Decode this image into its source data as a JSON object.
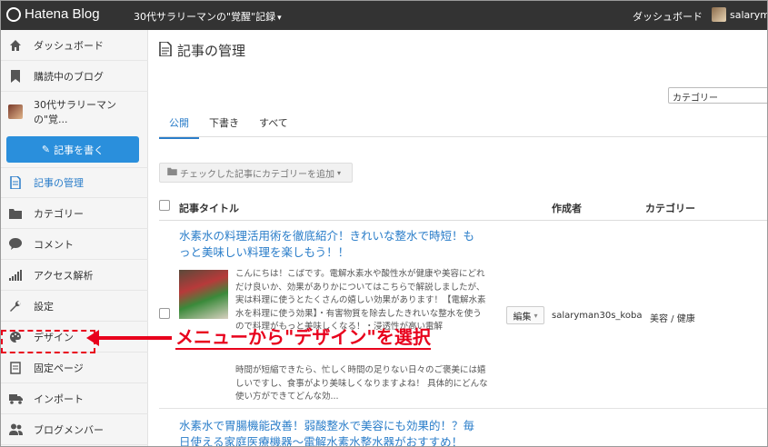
{
  "topbar": {
    "logo": "Hatena Blog",
    "blog_name": "30代サラリーマンの\"覚醒\"記録",
    "dashboard_link": "ダッシュボード",
    "username": "salaryma"
  },
  "sidebar": {
    "items": [
      {
        "label": "ダッシュボード",
        "icon": "home-icon"
      },
      {
        "label": "購読中のブログ",
        "icon": "bookmark-icon"
      },
      {
        "label": "30代サラリーマンの\"覚...",
        "icon": "blog-avatar"
      },
      {
        "label": "記事の管理",
        "icon": "document-icon"
      },
      {
        "label": "カテゴリー",
        "icon": "folder-icon"
      },
      {
        "label": "コメント",
        "icon": "comment-icon"
      },
      {
        "label": "アクセス解析",
        "icon": "bar-chart-icon"
      },
      {
        "label": "設定",
        "icon": "wrench-icon"
      },
      {
        "label": "デザイン",
        "icon": "palette-icon"
      },
      {
        "label": "固定ページ",
        "icon": "page-icon"
      },
      {
        "label": "インポート",
        "icon": "truck-icon"
      },
      {
        "label": "ブログメンバー",
        "icon": "members-icon"
      }
    ],
    "write_button": "記事を書く"
  },
  "main": {
    "title": "記事の管理",
    "category_select": "カテゴリー",
    "tabs": [
      "公開",
      "下書き",
      "すべて"
    ],
    "bulk_button": "チェックした記事にカテゴリーを追加",
    "columns": [
      "記事タイトル",
      "作成者",
      "カテゴリー"
    ],
    "posts": [
      {
        "title": "水素水の料理活用術を徹底紹介！きれいな整水で時短！もっと美味しい料理を楽しもう！！",
        "excerpt": "こんにちは！こばです。電解水素水や酸性水が健康や美容にどれだけ良いか、効果がありかについてはこちらで解説しましたが、実は料理に使うとたくさんの嬉しい効果があります！【電解水素水を料理に使う効果】・有害物質を除去したきれいな整水を使うので料理がもっと美味しくなる！・浸透性が高い電解",
        "excerpt_tail": "時間が短縮できたら、忙しく時間の足りない日々のご褒美には嬉しいですし、食事がより美味しくなりますよね！ 具体的にどんな使い方ができてどんな効...",
        "edit_label": "編集",
        "author": "salaryman30s_koba",
        "category": "美容 / 健康"
      },
      {
        "title": "水素水で胃腸機能改善！弱酸整水で美容にも効果的！？毎日使える家庭医療機器～電解水素水整水器がおすすめ！"
      }
    ]
  },
  "annotation": {
    "text": "メニューから\"デザイン\"を選択",
    "color": "#e8001c"
  }
}
